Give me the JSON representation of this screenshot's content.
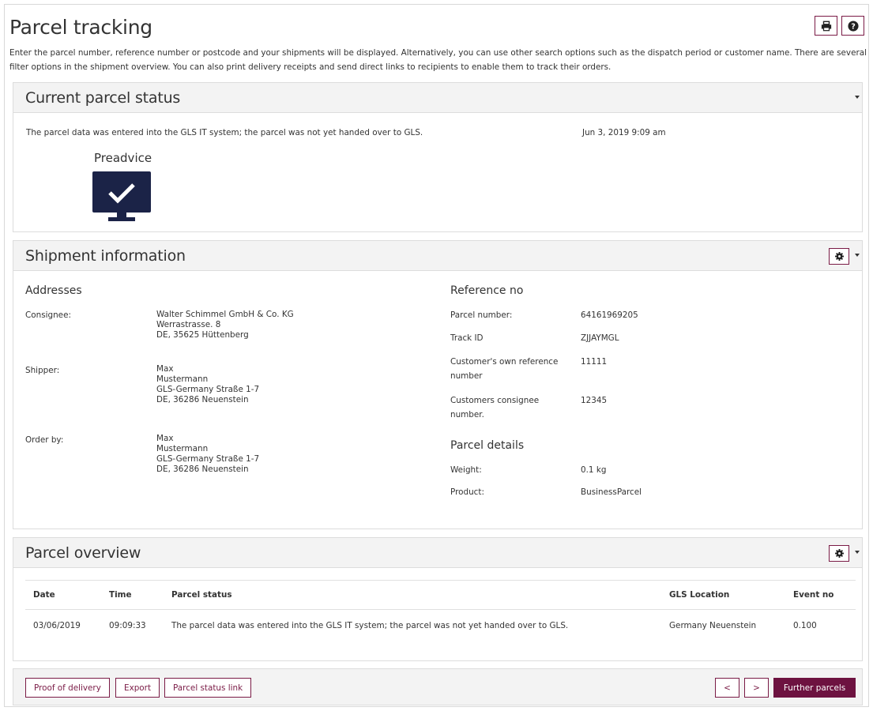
{
  "page": {
    "title": "Parcel tracking",
    "intro": "Enter the parcel number, reference number or postcode and your shipments will be displayed. Alternatively, you can use other search options such as the dispatch period or customer name. There are several filter options in the shipment overview. You can also print delivery receipts and send direct links to recipients to enable them to track their orders.",
    "tools": {
      "print_icon": "print-icon",
      "help_icon": "question-icon"
    }
  },
  "current_status": {
    "title": "Current parcel status",
    "text": "The parcel data was entered into the GLS IT system; the parcel was not yet handed over to GLS.",
    "datetime": "Jun 3, 2019 9:09 am",
    "step_label": "Preadvice",
    "step_icon": "monitor-check-icon"
  },
  "shipment": {
    "title": "Shipment information",
    "addresses_heading": "Addresses",
    "consignee_label": "Consignee:",
    "consignee_lines": [
      "Walter Schimmel GmbH & Co. KG",
      "Werrastrasse. 8",
      "DE, 35625 Hüttenberg"
    ],
    "shipper_label": "Shipper:",
    "shipper_lines": [
      "Max",
      "Mustermann",
      "GLS-Germany Straße 1-7",
      "DE, 36286 Neuenstein"
    ],
    "order_label": "Order by:",
    "order_lines": [
      "Max",
      "Mustermann",
      "GLS-Germany Straße 1-7",
      "DE, 36286 Neuenstein"
    ],
    "reference_heading": "Reference no",
    "parcel_number_label": "Parcel number:",
    "parcel_number": "64161969205",
    "track_id_label": "Track ID",
    "track_id": "ZJJAYMGL",
    "own_ref_label_1": "Customer's own reference",
    "own_ref_label_2": "number",
    "own_ref": "11111",
    "consignee_no_label_1": "Customers consignee",
    "consignee_no_label_2": "number.",
    "consignee_no": "12345",
    "details_heading": "Parcel details",
    "weight_label": "Weight:",
    "weight": "0.1 kg",
    "product_label": "Product:",
    "product": "BusinessParcel"
  },
  "overview": {
    "title": "Parcel overview",
    "columns": [
      "Date",
      "Time",
      "Parcel status",
      "GLS Location",
      "Event no"
    ],
    "rows": [
      [
        "03/06/2019",
        "09:09:33",
        "The parcel data was entered into the GLS IT system; the parcel was not yet handed over to GLS.",
        "Germany Neuenstein",
        "0.100"
      ]
    ]
  },
  "footer": {
    "proof": "Proof of delivery",
    "export": "Export",
    "status_link": "Parcel status link",
    "prev": "<",
    "next": ">",
    "further": "Further parcels"
  },
  "colors": {
    "brand": "#6d1240",
    "icon_navy": "#1b2347",
    "panel_head": "#f3f3f3"
  }
}
